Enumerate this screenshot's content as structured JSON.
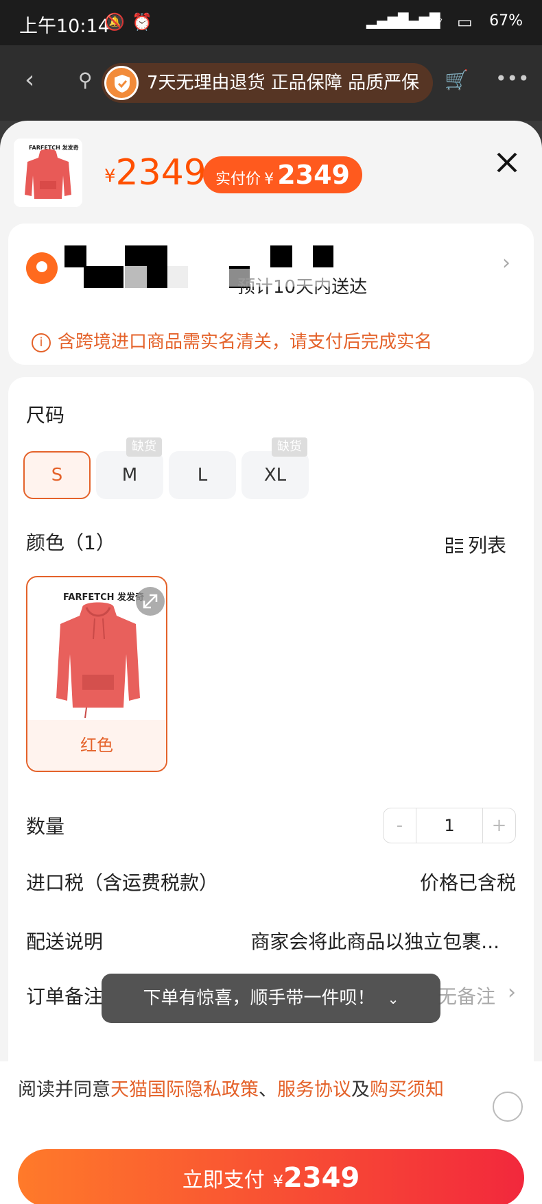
{
  "status_bar": {
    "time": "上午10:14",
    "battery": "67%"
  },
  "guarantee": "7天无理由退货 正品保障 品质严保",
  "product": {
    "brand": "FARFETCH 发发奇",
    "price_symbol": "¥",
    "price": "2349",
    "paid_label": "实付价",
    "paid_symbol": "¥",
    "paid_price": "2349"
  },
  "address": {
    "delivery_text": "预计10天内送达",
    "notice": "含跨境进口商品需实名清关，请支付后完成实名"
  },
  "size": {
    "label": "尺码",
    "options": [
      {
        "label": "S",
        "badge": ""
      },
      {
        "label": "M",
        "badge": "缺货"
      },
      {
        "label": "L",
        "badge": ""
      },
      {
        "label": "XL",
        "badge": "缺货"
      }
    ],
    "selected": "S"
  },
  "color": {
    "label": "颜色（1）",
    "list_toggle": "列表",
    "options": [
      {
        "name": "红色",
        "brand": "FARFETCH 发发奇"
      }
    ]
  },
  "quantity": {
    "label": "数量",
    "minus": "-",
    "value": "1",
    "plus": "+"
  },
  "import_tax": {
    "label": "进口税（含运费税款）",
    "value": "价格已含税"
  },
  "shipping": {
    "label": "配送说明",
    "value": "商家会将此商品以独立包裹..."
  },
  "order_note": {
    "label": "订单备注",
    "value": "无备注"
  },
  "toast": "下单有惊喜，顺手带一件呗！",
  "agreement": {
    "prefix": "阅读并同意",
    "link1": "天猫国际隐私政策",
    "sep": "、",
    "link2": "服务协议",
    "and": "及",
    "link3": "购买须知"
  },
  "pay_button": {
    "label": "立即支付",
    "symbol": "¥",
    "amount": "2349"
  },
  "colors": {
    "accent": "#e4622a",
    "price": "#ff5000",
    "pay_start": "#ff7a2a",
    "pay_end": "#f2283c"
  }
}
